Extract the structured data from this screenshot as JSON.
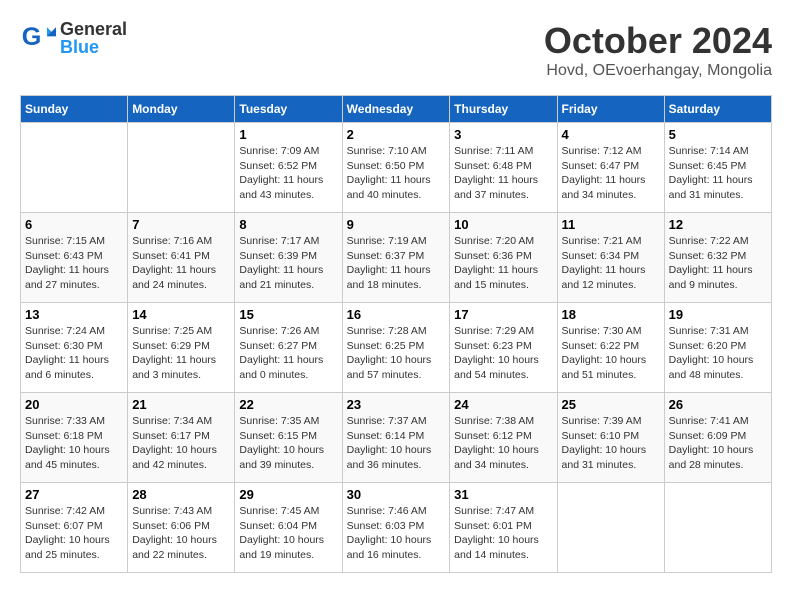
{
  "header": {
    "logo": {
      "general": "General",
      "blue": "Blue"
    },
    "title": "October 2024",
    "location": "Hovd, OEvoerhangay, Mongolia"
  },
  "calendar": {
    "days_of_week": [
      "Sunday",
      "Monday",
      "Tuesday",
      "Wednesday",
      "Thursday",
      "Friday",
      "Saturday"
    ],
    "weeks": [
      [
        {
          "day": "",
          "info": ""
        },
        {
          "day": "",
          "info": ""
        },
        {
          "day": "1",
          "info": "Sunrise: 7:09 AM\nSunset: 6:52 PM\nDaylight: 11 hours and 43 minutes."
        },
        {
          "day": "2",
          "info": "Sunrise: 7:10 AM\nSunset: 6:50 PM\nDaylight: 11 hours and 40 minutes."
        },
        {
          "day": "3",
          "info": "Sunrise: 7:11 AM\nSunset: 6:48 PM\nDaylight: 11 hours and 37 minutes."
        },
        {
          "day": "4",
          "info": "Sunrise: 7:12 AM\nSunset: 6:47 PM\nDaylight: 11 hours and 34 minutes."
        },
        {
          "day": "5",
          "info": "Sunrise: 7:14 AM\nSunset: 6:45 PM\nDaylight: 11 hours and 31 minutes."
        }
      ],
      [
        {
          "day": "6",
          "info": "Sunrise: 7:15 AM\nSunset: 6:43 PM\nDaylight: 11 hours and 27 minutes."
        },
        {
          "day": "7",
          "info": "Sunrise: 7:16 AM\nSunset: 6:41 PM\nDaylight: 11 hours and 24 minutes."
        },
        {
          "day": "8",
          "info": "Sunrise: 7:17 AM\nSunset: 6:39 PM\nDaylight: 11 hours and 21 minutes."
        },
        {
          "day": "9",
          "info": "Sunrise: 7:19 AM\nSunset: 6:37 PM\nDaylight: 11 hours and 18 minutes."
        },
        {
          "day": "10",
          "info": "Sunrise: 7:20 AM\nSunset: 6:36 PM\nDaylight: 11 hours and 15 minutes."
        },
        {
          "day": "11",
          "info": "Sunrise: 7:21 AM\nSunset: 6:34 PM\nDaylight: 11 hours and 12 minutes."
        },
        {
          "day": "12",
          "info": "Sunrise: 7:22 AM\nSunset: 6:32 PM\nDaylight: 11 hours and 9 minutes."
        }
      ],
      [
        {
          "day": "13",
          "info": "Sunrise: 7:24 AM\nSunset: 6:30 PM\nDaylight: 11 hours and 6 minutes."
        },
        {
          "day": "14",
          "info": "Sunrise: 7:25 AM\nSunset: 6:29 PM\nDaylight: 11 hours and 3 minutes."
        },
        {
          "day": "15",
          "info": "Sunrise: 7:26 AM\nSunset: 6:27 PM\nDaylight: 11 hours and 0 minutes."
        },
        {
          "day": "16",
          "info": "Sunrise: 7:28 AM\nSunset: 6:25 PM\nDaylight: 10 hours and 57 minutes."
        },
        {
          "day": "17",
          "info": "Sunrise: 7:29 AM\nSunset: 6:23 PM\nDaylight: 10 hours and 54 minutes."
        },
        {
          "day": "18",
          "info": "Sunrise: 7:30 AM\nSunset: 6:22 PM\nDaylight: 10 hours and 51 minutes."
        },
        {
          "day": "19",
          "info": "Sunrise: 7:31 AM\nSunset: 6:20 PM\nDaylight: 10 hours and 48 minutes."
        }
      ],
      [
        {
          "day": "20",
          "info": "Sunrise: 7:33 AM\nSunset: 6:18 PM\nDaylight: 10 hours and 45 minutes."
        },
        {
          "day": "21",
          "info": "Sunrise: 7:34 AM\nSunset: 6:17 PM\nDaylight: 10 hours and 42 minutes."
        },
        {
          "day": "22",
          "info": "Sunrise: 7:35 AM\nSunset: 6:15 PM\nDaylight: 10 hours and 39 minutes."
        },
        {
          "day": "23",
          "info": "Sunrise: 7:37 AM\nSunset: 6:14 PM\nDaylight: 10 hours and 36 minutes."
        },
        {
          "day": "24",
          "info": "Sunrise: 7:38 AM\nSunset: 6:12 PM\nDaylight: 10 hours and 34 minutes."
        },
        {
          "day": "25",
          "info": "Sunrise: 7:39 AM\nSunset: 6:10 PM\nDaylight: 10 hours and 31 minutes."
        },
        {
          "day": "26",
          "info": "Sunrise: 7:41 AM\nSunset: 6:09 PM\nDaylight: 10 hours and 28 minutes."
        }
      ],
      [
        {
          "day": "27",
          "info": "Sunrise: 7:42 AM\nSunset: 6:07 PM\nDaylight: 10 hours and 25 minutes."
        },
        {
          "day": "28",
          "info": "Sunrise: 7:43 AM\nSunset: 6:06 PM\nDaylight: 10 hours and 22 minutes."
        },
        {
          "day": "29",
          "info": "Sunrise: 7:45 AM\nSunset: 6:04 PM\nDaylight: 10 hours and 19 minutes."
        },
        {
          "day": "30",
          "info": "Sunrise: 7:46 AM\nSunset: 6:03 PM\nDaylight: 10 hours and 16 minutes."
        },
        {
          "day": "31",
          "info": "Sunrise: 7:47 AM\nSunset: 6:01 PM\nDaylight: 10 hours and 14 minutes."
        },
        {
          "day": "",
          "info": ""
        },
        {
          "day": "",
          "info": ""
        }
      ]
    ]
  }
}
